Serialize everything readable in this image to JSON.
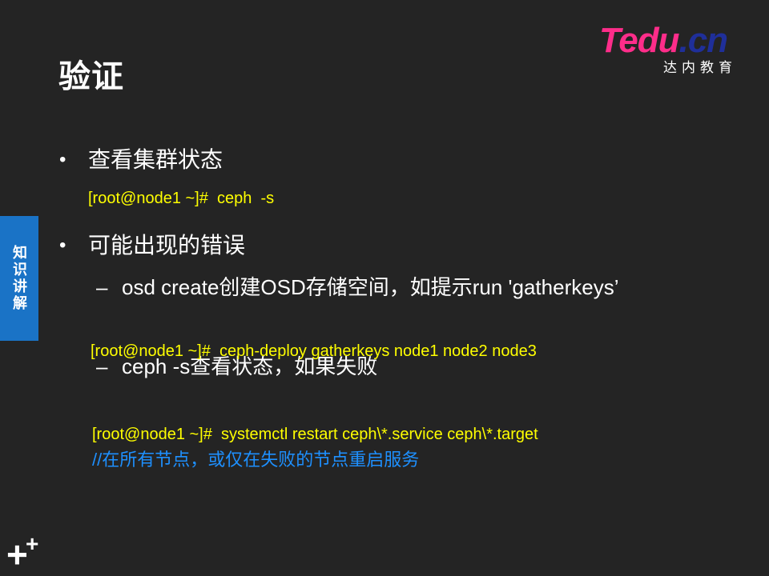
{
  "slide": {
    "title": "验证",
    "logo": {
      "brand_pink": "Tedu",
      "brand_blue": ".cn",
      "subtitle": "达内教育"
    },
    "side_tab": "知识讲解",
    "bullets": [
      {
        "text": "查看集群状态",
        "command": "[root@node1 ~]#  ceph  -s"
      },
      {
        "text": "可能出现的错误",
        "subitems": [
          {
            "text": "osd create创建OSD存储空间，如提示run 'gatherkeys’",
            "command": "[root@node1 ~]#  ceph-deploy gatherkeys node1 node2 node3"
          },
          {
            "text": "ceph -s查看状态，如果失败",
            "command": "[root@node1 ~]#  systemctl restart ceph\\*.service ceph\\*.target",
            "comment": "//在所有节点，或仅在失败的节点重启服务"
          }
        ]
      }
    ],
    "bullet_glyph": "•",
    "dash_glyph": "–",
    "corner_plus": "+",
    "colors": {
      "background": "#242424",
      "command": "#ffff00",
      "comment": "#1e90ff",
      "side_tab": "#1a73c6"
    }
  }
}
